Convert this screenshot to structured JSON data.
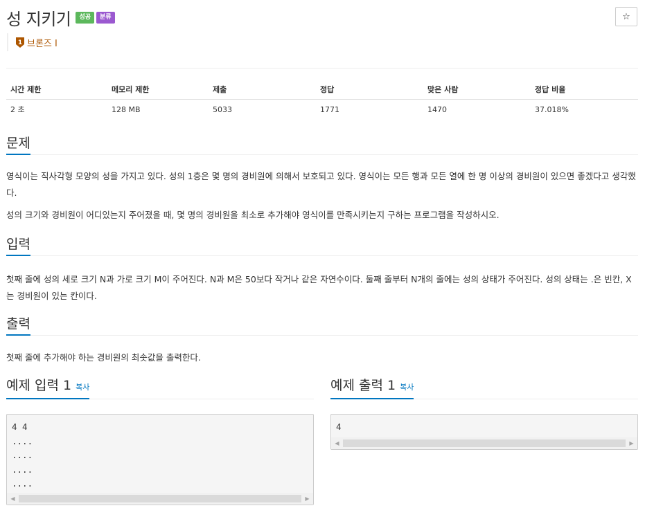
{
  "problem": {
    "title": "성 지키기",
    "badges": {
      "success": "성공",
      "tag": "분류"
    },
    "tier": {
      "number": "1",
      "label": "브론즈 I"
    },
    "star": "☆"
  },
  "info_table": {
    "headers": [
      "시간 제한",
      "메모리 제한",
      "제출",
      "정답",
      "맞은 사람",
      "정답 비율"
    ],
    "values": [
      "2 초",
      "128 MB",
      "5033",
      "1771",
      "1470",
      "37.018%"
    ]
  },
  "sections": {
    "problem_heading": "문제",
    "problem_p1": "영식이는 직사각형 모양의 성을 가지고 있다. 성의 1층은 몇 명의 경비원에 의해서 보호되고 있다. 영식이는 모든 행과 모든 열에 한 명 이상의 경비원이 있으면 좋겠다고 생각했다.",
    "problem_p2": "성의 크기와 경비원이 어디있는지 주어졌을 때, 몇 명의 경비원을 최소로 추가해야 영식이를 만족시키는지 구하는 프로그램을 작성하시오.",
    "input_heading": "입력",
    "input_text": "첫째 줄에 성의 세로 크기 N과 가로 크기 M이 주어진다. N과 M은 50보다 작거나 같은 자연수이다. 둘째 줄부터 N개의 줄에는 성의 상태가 주어진다. 성의 상태는 .은 빈칸, X는 경비원이 있는 칸이다.",
    "output_heading": "출력",
    "output_text": "첫째 줄에 추가해야 하는 경비원의 최솟값을 출력한다."
  },
  "samples": {
    "input_title": "예제 입력 1",
    "output_title": "예제 출력 1",
    "copy_label": "복사",
    "input_code": "4 4\n....\n....\n....\n....",
    "output_code": "4"
  }
}
